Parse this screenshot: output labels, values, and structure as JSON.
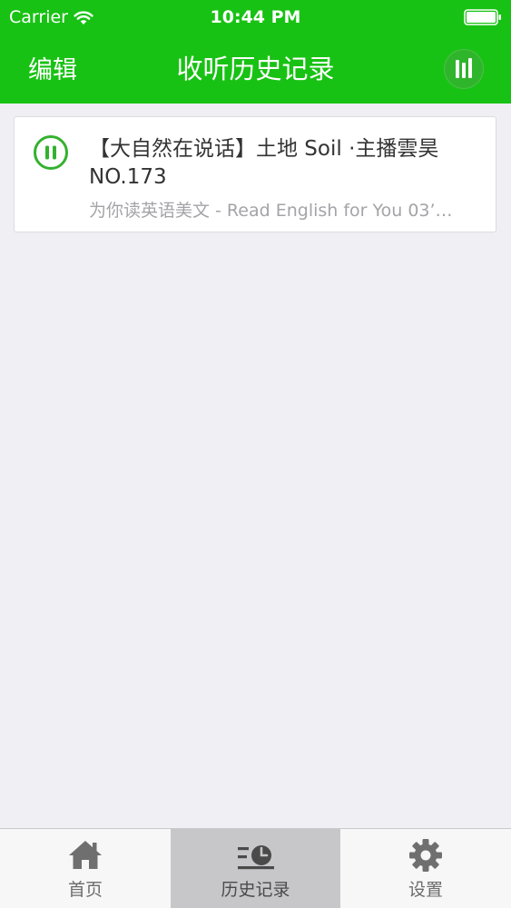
{
  "status_bar": {
    "carrier": "Carrier",
    "time": "10:44 PM"
  },
  "nav": {
    "edit_label": "编辑",
    "title": "收听历史记录",
    "player_icon": "equalizer-icon"
  },
  "history": {
    "items": [
      {
        "title": "【大自然在说话】土地 Soil ·主播雲昊 NO.173",
        "subtitle": "为你读英语美文 - Read English for You  03’…",
        "state_icon": "pause-icon"
      }
    ]
  },
  "tabs": [
    {
      "label": "首页",
      "icon": "home-icon",
      "active": false
    },
    {
      "label": "历史记录",
      "icon": "history-icon",
      "active": true
    },
    {
      "label": "设置",
      "icon": "gear-icon",
      "active": false
    }
  ],
  "colors": {
    "brand_green": "#18c214",
    "ring_green": "#34b12f",
    "background": "#efeff4",
    "tab_active": "#c7c7c9"
  }
}
